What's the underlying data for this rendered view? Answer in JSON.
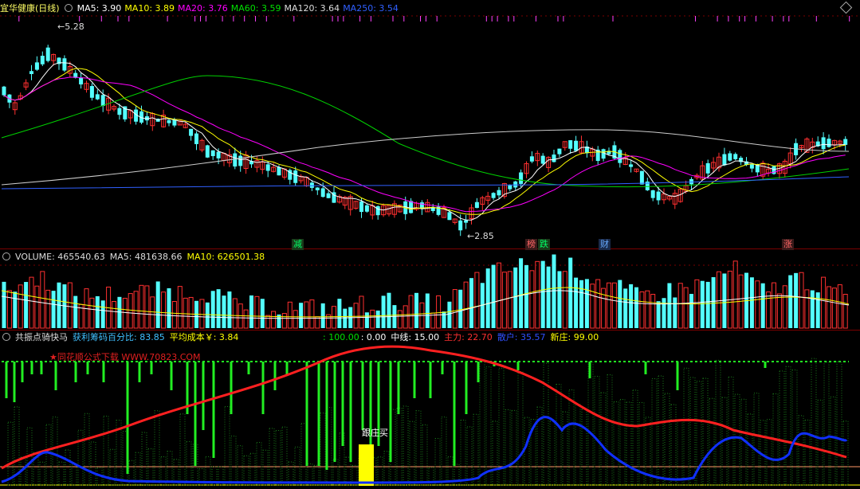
{
  "panel_price": {
    "stock_name": "宜华健康",
    "period": "(日线)",
    "ma": [
      {
        "label": "MA5: 3.90",
        "color": "#ffffff"
      },
      {
        "label": "MA10: 3.89",
        "color": "#ffff00"
      },
      {
        "label": "MA20: 3.76",
        "color": "#ff00ff"
      },
      {
        "label": "MA60: 3.59",
        "color": "#00e000"
      },
      {
        "label": "MA120: 3.64",
        "color": "#dddddd"
      },
      {
        "label": "MA250: 3.54",
        "color": "#3060ff"
      }
    ],
    "high_label": "5.28",
    "low_label": "2.85",
    "events": [
      {
        "text": "减",
        "color": "#00ff66"
      },
      {
        "text": "榜",
        "color": "#ff6666"
      },
      {
        "text": "跌",
        "color": "#00ff66"
      },
      {
        "text": "财",
        "color": "#66aaff"
      },
      {
        "text": "涨",
        "color": "#ff6666"
      }
    ]
  },
  "panel_volume": {
    "title": "VOLUME: 465540.63",
    "ma5": "MA5: 481638.66",
    "ma10": "MA10: 626501.38"
  },
  "panel_indicator": {
    "name": "共振点骑快马",
    "profit_ratio": "获利筹码百分比: 83.85",
    "avg_cost": "平均成本￥: 3.84",
    "line100": ": 100.00",
    "line0": ": 0.00",
    "midline": "中线: 15.00",
    "main": "主力: 22.70",
    "retail": "散户: 35.57",
    "new_dealer": "新庄: 99.00",
    "watermark": "★同花顺公式下载 WWW.70823.COM",
    "signal": "跟庄买"
  },
  "colors": {
    "up": "#ff3030",
    "down": "#54ffff",
    "bg": "#000000",
    "grid": "#7a0000"
  }
}
